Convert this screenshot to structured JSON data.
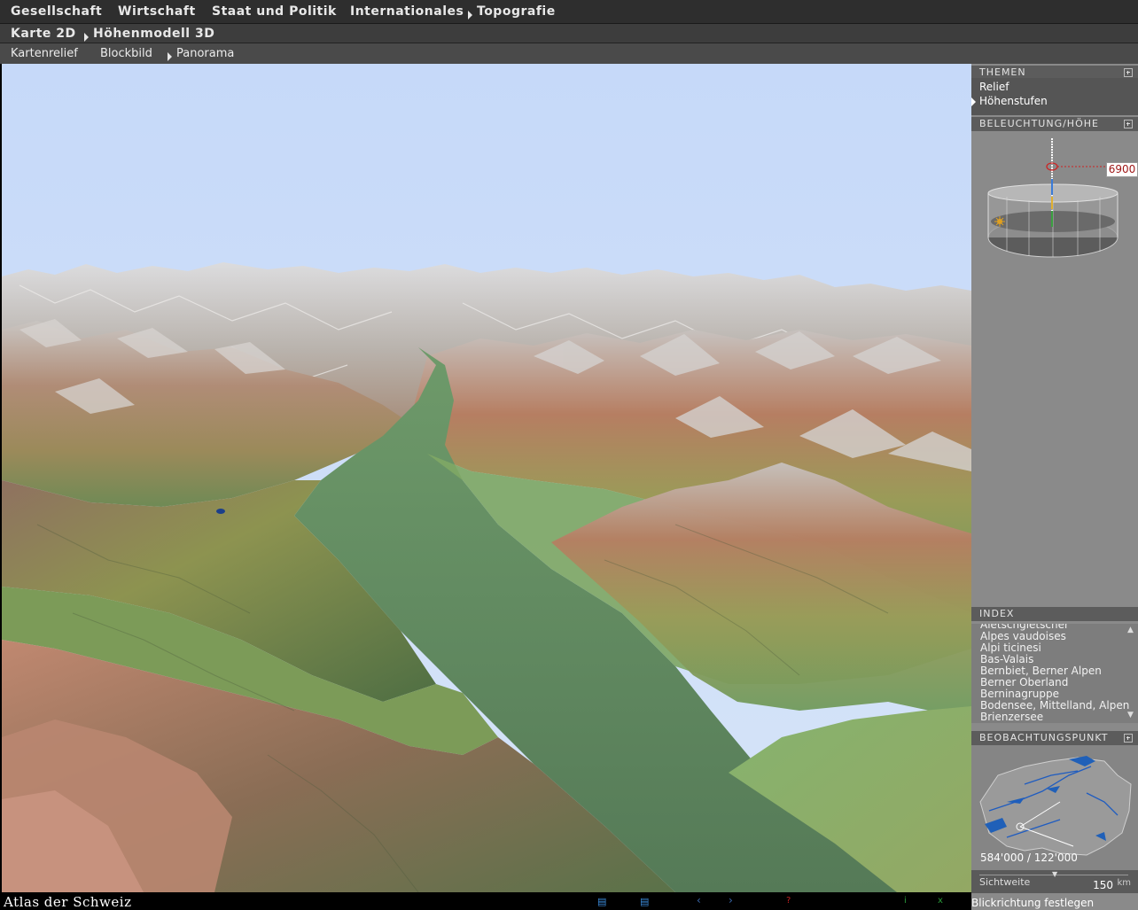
{
  "menu_main": [
    "Gesellschaft",
    "Wirtschaft",
    "Staat und Politik",
    "Internationales",
    "Topografie"
  ],
  "menu_sub": [
    "Karte 2D",
    "Höhenmodell 3D"
  ],
  "menu_view": [
    "Kartenrelief",
    "Blockbild",
    "Panorama"
  ],
  "themes": {
    "title": "THEMEN",
    "items": [
      "Relief",
      "Höhenstufen"
    ],
    "active": "Höhenstufen"
  },
  "lighting": {
    "title": "BELEUCHTUNG/HÖHE",
    "height_value": "6900"
  },
  "index": {
    "title": "INDEX",
    "items": [
      "Aletschgletscher",
      "Alpes vaudoises",
      "Alpi ticinesi",
      "Bas-Valais",
      "Bernbiet, Berner Alpen",
      "Berner Oberland",
      "Berninagruppe",
      "Bodensee, Mittelland, Alpen",
      "Brienzersee"
    ]
  },
  "observation": {
    "title": "BEOBACHTUNGSPUNKT",
    "coordinates": "584'000 / 122'000",
    "range_label": "Sichtweite",
    "range_value": "150",
    "range_unit": "km"
  },
  "status": {
    "logo_main": "Atlas der Schweiz",
    "hint": "Blickrichtung festlegen"
  },
  "colors": {
    "sky": "#c9dbf8",
    "valley": "#5f8a63",
    "ridge_brown": "#a77b62",
    "snow": "#c8c6c4",
    "accent_red": "#cc2222"
  }
}
